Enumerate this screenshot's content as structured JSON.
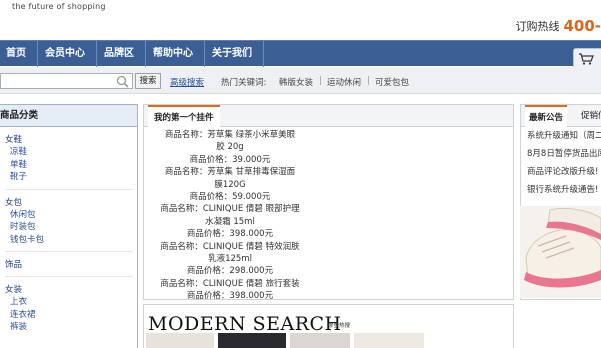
{
  "header": {
    "tagline": "the future of shopping",
    "hotline_label": "订购热线",
    "hotline_number": "400-"
  },
  "nav": {
    "items": [
      "首页",
      "会员中心",
      "品牌区",
      "帮助中心",
      "关于我们"
    ]
  },
  "search": {
    "placeholder": "",
    "button_label": "搜索",
    "advanced_label": "高级搜索",
    "hot_label": "热门关键词:",
    "keywords": [
      "韩版女装",
      "运动休闲",
      "可爱包包"
    ]
  },
  "sidebar": {
    "title": "商品分类",
    "groups": [
      {
        "title": "女鞋",
        "items": [
          "凉鞋",
          "单鞋",
          "靴子"
        ]
      },
      {
        "title": "女包",
        "items": [
          "休闲包",
          "时装包",
          "钱包卡包"
        ]
      },
      {
        "title": "饰品",
        "items": []
      },
      {
        "title": "女装",
        "items": [
          "上衣",
          "连衣裙",
          "裤装"
        ]
      }
    ]
  },
  "plugin": {
    "tab_label": "我的第一个挂件",
    "lines": [
      "商品名称：芳草集 绿茶小米草美眼",
      "胶 20g",
      "商品价格：39.000元",
      "商品名称：芳草集 甘草排毒保湿面",
      "膜120G",
      "商品价格：59.000元",
      "商品名称：CLINIQUE 倩碧 眼部护理",
      "水凝霜 15ml",
      "商品价格：398.000元",
      "商品名称：CLINIQUE 倩碧 特效润肤",
      "乳液125ml",
      "商品价格：298.000元",
      "商品名称：CLINIQUE 倩碧 旅行套装",
      "商品价格：398.000元"
    ]
  },
  "banner": {
    "title": "MODERN SEARCH",
    "subtitle": "摩登热搜"
  },
  "right": {
    "tab_active": "最新公告",
    "tab_other": "促销信",
    "news": [
      "系统升级通知（周二",
      "8月8日暂停货品出库",
      "商品评论改版升级!",
      "银行系统升级通告!"
    ]
  },
  "colors": {
    "nav_bg": "#3b5f94",
    "accent_orange": "#e06414",
    "link_blue": "#1f4e9a"
  }
}
